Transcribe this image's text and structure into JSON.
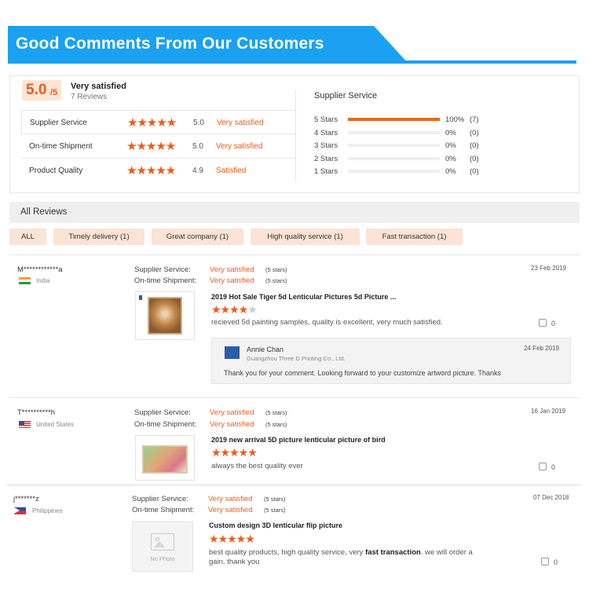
{
  "header": {
    "title": "Good Comments From Our Customers"
  },
  "summary": {
    "score": "5.0",
    "score_max": "/5",
    "label": "Very satisfied",
    "review_count": "7 Reviews",
    "metrics": [
      {
        "name": "Supplier Service",
        "stars": "★★★★★",
        "score": "5.0",
        "text": "Very satisfied"
      },
      {
        "name": "On-time Shipment",
        "stars": "★★★★★",
        "score": "5.0",
        "text": "Very satisfied"
      },
      {
        "name": "Product Quality",
        "stars": "★★★★★",
        "score": "4.9",
        "text": "Satisfied"
      }
    ],
    "distribution_title": "Supplier Service",
    "distribution": [
      {
        "label": "5  Stars",
        "fraction": 1.0,
        "percent": "100%",
        "count": "(7)"
      },
      {
        "label": "4  Stars",
        "fraction": 0,
        "percent": "0%",
        "count": "(0)"
      },
      {
        "label": "3  Stars",
        "fraction": 0,
        "percent": "0%",
        "count": "(0)"
      },
      {
        "label": "2  Stars",
        "fraction": 0,
        "percent": "0%",
        "count": "(0)"
      },
      {
        "label": "1  Stars",
        "fraction": 0,
        "percent": "0%",
        "count": "(0)"
      }
    ]
  },
  "all_reviews": {
    "title": "All Reviews",
    "tags": [
      "ALL",
      "Timely delivery (1)",
      "Great company (1)",
      "High quality service (1)",
      "Fast transaction (1)"
    ]
  },
  "labels": {
    "supplier_service": "Supplier Service:",
    "ontime_shipment": "On-time Shipment:"
  },
  "reviews": [
    {
      "name": "M************a",
      "country": "India",
      "supplier_service": "Very satisfied",
      "supplier_service_note": "(5 stars)",
      "ontime_shipment": "Very satisfied",
      "ontime_shipment_note": "(5 stars)",
      "date": "23 Feb 2019",
      "product_title": "2019 Hot Sale Tiger 5d Lenticular Pictures 5d Picture ...",
      "rating": 4,
      "stars_on": "★★★★",
      "stars_off": "★",
      "comment": "recieved 5d painting samples, quality is excellent, very much satisfied.",
      "likes": "0",
      "reply": {
        "name": "Annie Chan",
        "company": "Guangzhou Three D Printing Co., Ltd.",
        "date": "24 Feb 2019",
        "text": "Thank you for your comment. Looking forward to your customize artword picture. Thanks"
      }
    },
    {
      "name": "T**********h",
      "country": "United States",
      "supplier_service": "Very satisfied",
      "supplier_service_note": "(5 stars)",
      "ontime_shipment": "Very satisfied",
      "ontime_shipment_note": "(5 stars)",
      "date": "16 Jan 2019",
      "product_title": "2019 new arrival 5D picture lenticular picture of bird",
      "rating": 5,
      "stars_on": "★★★★★",
      "comment": "always the best quality ever",
      "likes": "0"
    },
    {
      "name": "j*******z",
      "country": "Philippines",
      "supplier_service": "Very satisfied",
      "supplier_service_note": "(5 stars)",
      "ontime_shipment": "Very satisfied",
      "ontime_shipment_note": "(5 stars)",
      "date": "07 Dec 2018",
      "product_title": "Custom design 3D lenticular flip picture",
      "rating": 5,
      "stars_on": "★★★★★",
      "comment_part1": "best quality products, high quality service, very ",
      "comment_bold": "fast transaction",
      "comment_part2": ". we will order a",
      "comment_line2": "gain. thank you",
      "no_photo": "No Photo",
      "likes": "0"
    }
  ],
  "colors": {
    "accent": "#f05a1a",
    "banner": "#1aa1f1",
    "tag_bg": "#fbe3d5"
  }
}
